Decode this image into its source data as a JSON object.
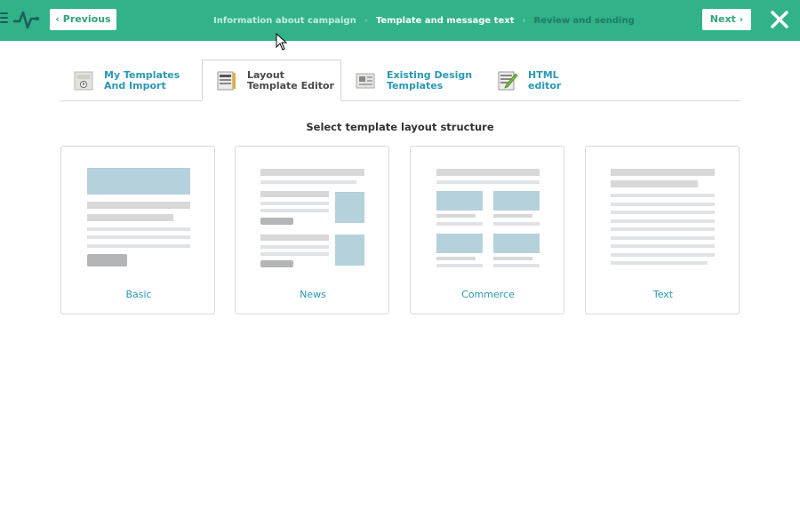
{
  "header": {
    "previous_label": "Previous",
    "next_label": "Next",
    "steps": [
      {
        "label": "Information about campaign",
        "state": "done"
      },
      {
        "label": "Template and message text",
        "state": "active"
      },
      {
        "label": "Review and sending",
        "state": "upcoming"
      }
    ],
    "accent_color": "#31b289"
  },
  "tabs": [
    {
      "line1": "My Templates",
      "line2": "And Import",
      "icon": "templates-import-icon"
    },
    {
      "line1": "Layout",
      "line2": "Template Editor",
      "icon": "layout-editor-icon",
      "active": true
    },
    {
      "line1": "Existing Design",
      "line2": "Templates",
      "icon": "design-templates-icon"
    },
    {
      "line1": "HTML",
      "line2": "editor",
      "icon": "html-editor-icon"
    }
  ],
  "section_title": "Select template layout structure",
  "layouts": [
    {
      "label": "Basic"
    },
    {
      "label": "News"
    },
    {
      "label": "Commerce"
    },
    {
      "label": "Text"
    }
  ]
}
